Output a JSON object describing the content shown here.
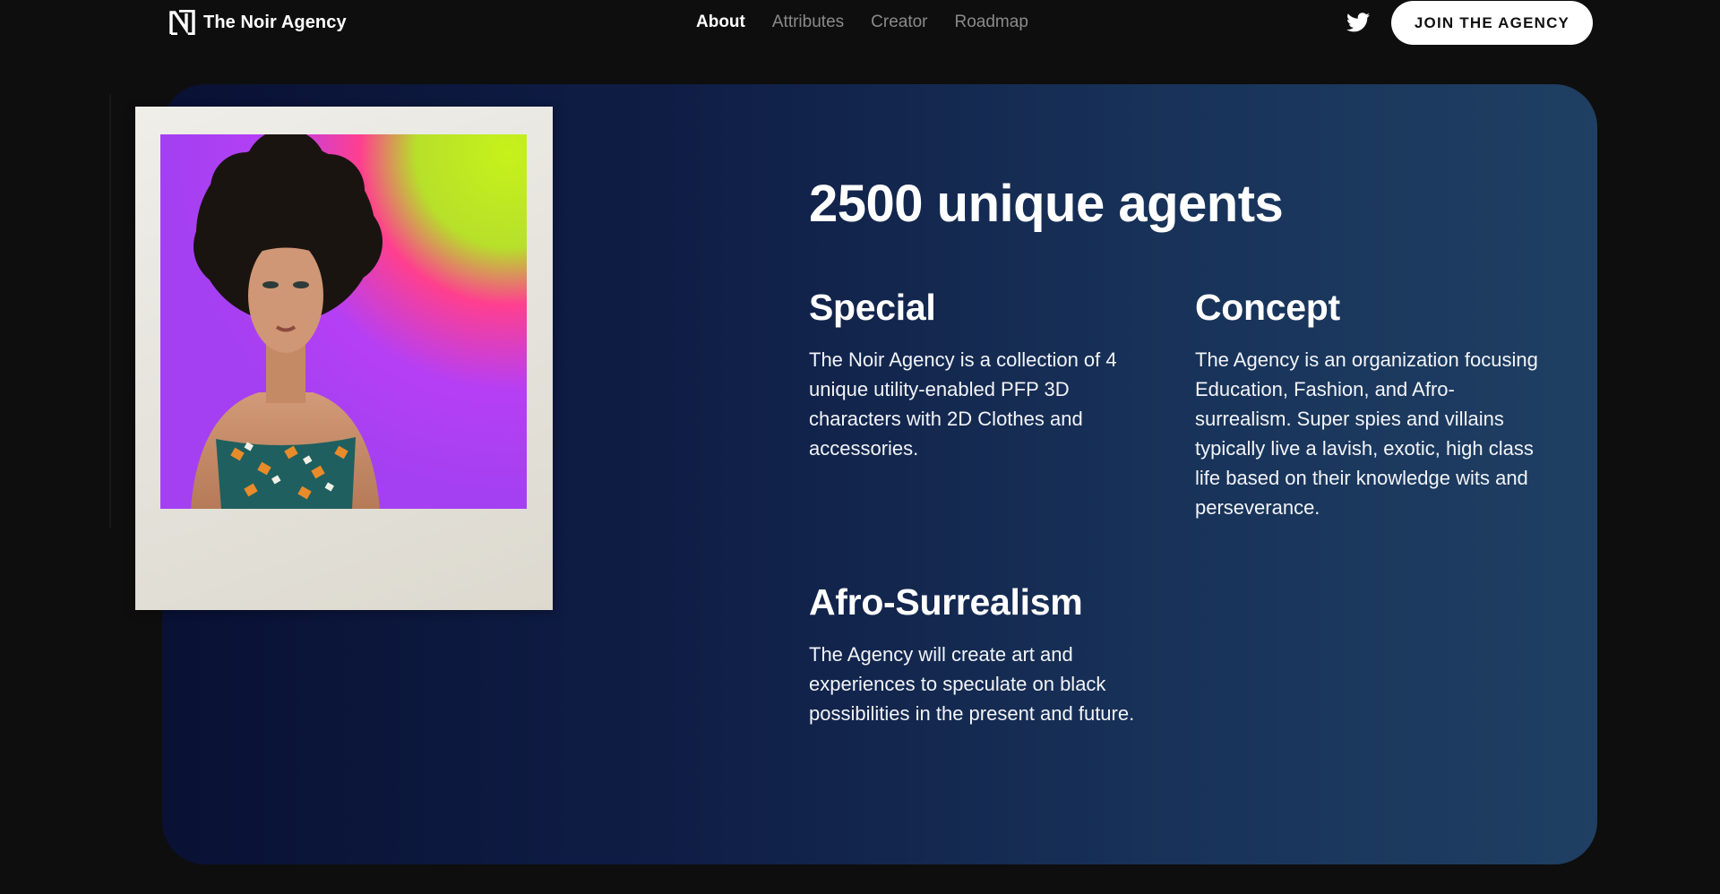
{
  "nav": {
    "brand_name": "The Noir Agency",
    "brand_logo_icon": "n-logo-icon",
    "links": [
      {
        "label": "About",
        "active": true
      },
      {
        "label": "Attributes",
        "active": false
      },
      {
        "label": "Creator",
        "active": false
      },
      {
        "label": "Roadmap",
        "active": false
      }
    ],
    "social_icon": "twitter-icon",
    "cta_label": "JOIN THE AGENCY"
  },
  "hero": {
    "heading": "2500 unique agents",
    "image_alt": "polaroid-portrait",
    "features": [
      {
        "title": "Special",
        "text": "The Noir Agency is a collection of 4 unique utility-enabled PFP 3D characters with 2D Clothes and accessories."
      },
      {
        "title": "Concept",
        "text": "The Agency is an organization focusing Education, Fashion, and Afro-surrealism. Super spies and villains typically live a lavish, exotic, high class life based on their knowledge wits and perseverance."
      },
      {
        "title": "Afro-Surrealism",
        "text": "The Agency will create art and experiences to speculate on black possibilities in the present and future."
      }
    ]
  },
  "colors": {
    "background": "#0e0e0e",
    "panel_start": "#091134",
    "panel_end": "#1f3f63",
    "nav_inactive": "#8a8a8a",
    "button_bg": "#ffffff",
    "button_text": "#111111"
  }
}
